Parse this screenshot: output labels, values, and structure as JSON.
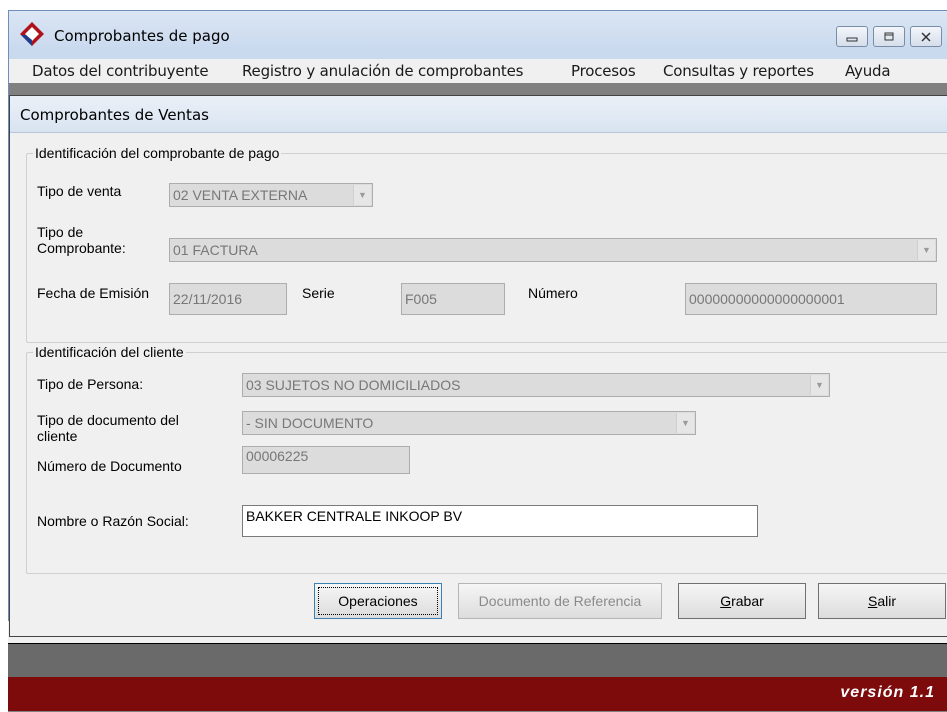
{
  "app": {
    "title": "Comprobantes de pago",
    "menu": [
      "Datos del contribuyente",
      "Registro y anulación de comprobantes",
      "Procesos",
      "Consultas y reportes",
      "Ayuda"
    ],
    "version": "versión 1.1"
  },
  "dialog": {
    "title": "Comprobantes de Ventas",
    "comprobante": {
      "legend": "Identificación del comprobante de pago",
      "tipo_venta_label": "Tipo de venta",
      "tipo_venta_value": "02 VENTA EXTERNA",
      "tipo_comprobante_label_1": "Tipo de",
      "tipo_comprobante_label_2": "Comprobante:",
      "tipo_comprobante_value": "01 FACTURA",
      "fecha_label": "Fecha de Emisión",
      "fecha_value": "22/11/2016",
      "serie_label": "Serie",
      "serie_value": "F005",
      "numero_label": "Número",
      "numero_value": "00000000000000000001"
    },
    "cliente": {
      "legend": "Identificación del cliente",
      "tipo_persona_label": "Tipo de Persona:",
      "tipo_persona_value": "03 SUJETOS NO DOMICILIADOS",
      "tipo_doc_label_1": "Tipo de documento del",
      "tipo_doc_label_2": "cliente",
      "tipo_doc_value": "- SIN DOCUMENTO",
      "numero_doc_label": "Número de Documento",
      "numero_doc_value": "00006225",
      "nombre_label": "Nombre o Razón Social:",
      "nombre_value": "BAKKER CENTRALE INKOOP BV"
    },
    "buttons": {
      "operaciones": "Operaciones",
      "documento_referencia": "Documento de Referencia",
      "grabar_u": "G",
      "grabar_rest": "rabar",
      "salir_u": "S",
      "salir_rest": "alir"
    }
  }
}
